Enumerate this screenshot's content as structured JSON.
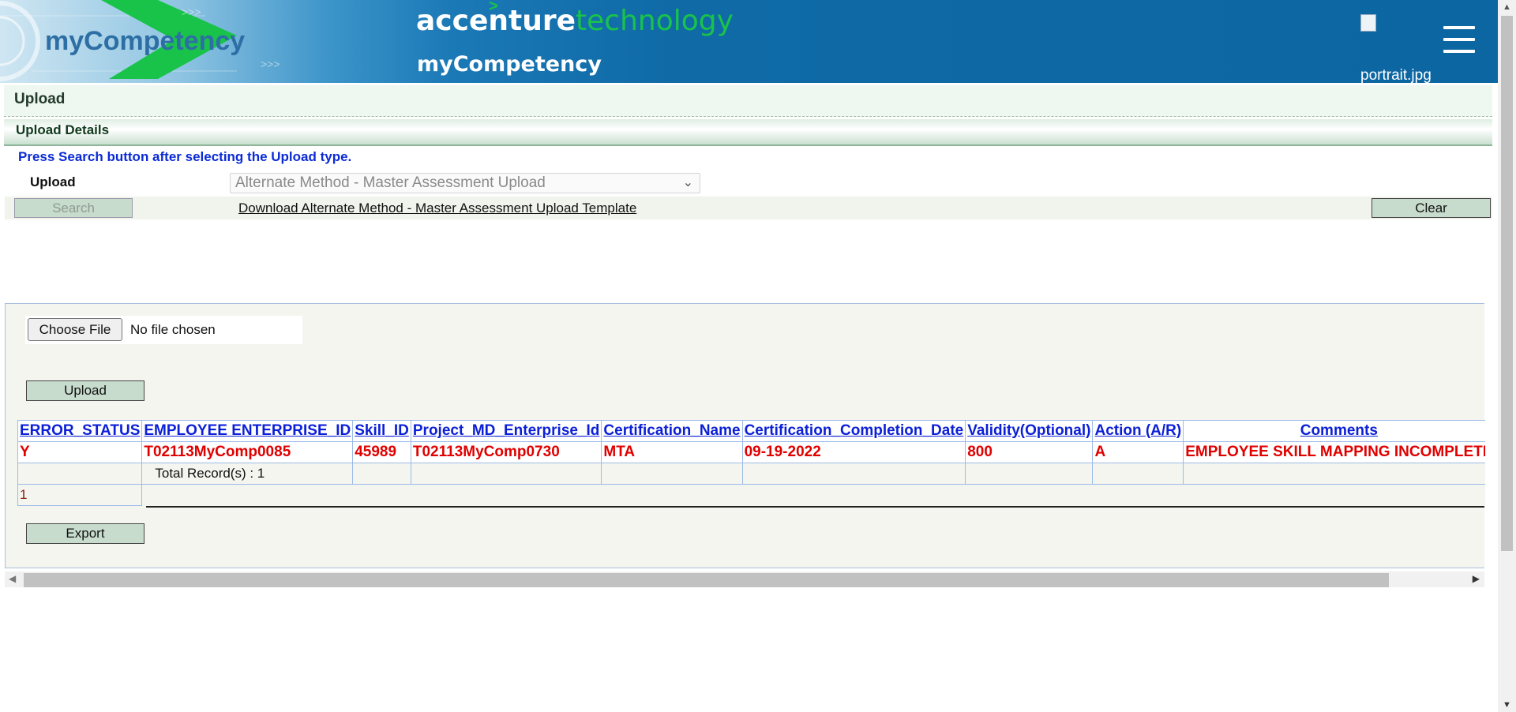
{
  "header": {
    "left_logo": "myCompetency",
    "brand_main": "accenture",
    "brand_tech": "technology",
    "brand_caret": ">",
    "app_name": "myCompetency",
    "portrait_alt": "portrait.jpg",
    "colors": {
      "header_blue": "#0c66a2",
      "brand_green": "#19c34a"
    }
  },
  "page": {
    "title": "Upload",
    "section_title": "Upload Details",
    "instruction": "Press Search button after selecting the Upload type."
  },
  "form": {
    "upload_label": "Upload",
    "upload_value": "Alternate Method - Master Assessment Upload",
    "search_label": "Search",
    "download_link": "Download Alternate Method - Master Assessment Upload Template",
    "clear_label": "Clear"
  },
  "file": {
    "choose_label": "Choose File",
    "status": "No file chosen",
    "upload_button": "Upload",
    "export_button": "Export"
  },
  "grid": {
    "columns": [
      "ERROR_STATUS",
      "EMPLOYEE ENTERPRISE_ID",
      "Skill_ID",
      "Project_MD_Enterprise_Id",
      "Certification_Name",
      "Certification_Completion_Date",
      "Validity(Optional)",
      "Action (A/R)",
      "Comments"
    ],
    "rows": [
      [
        "Y",
        "T02113MyComp0085",
        "45989",
        "T02113MyComp0730",
        "MTA",
        "09-19-2022",
        "800",
        "A",
        "EMPLOYEE SKILL MAPPING INCOMPLETE"
      ]
    ],
    "total_text": "Total Record(s) : 1",
    "page_number": "1"
  },
  "icons": {
    "menu": "hamburger-icon",
    "dropdown": "chevron-down-icon",
    "scroll_left": "arrow-left-icon",
    "scroll_right": "arrow-right-icon"
  }
}
